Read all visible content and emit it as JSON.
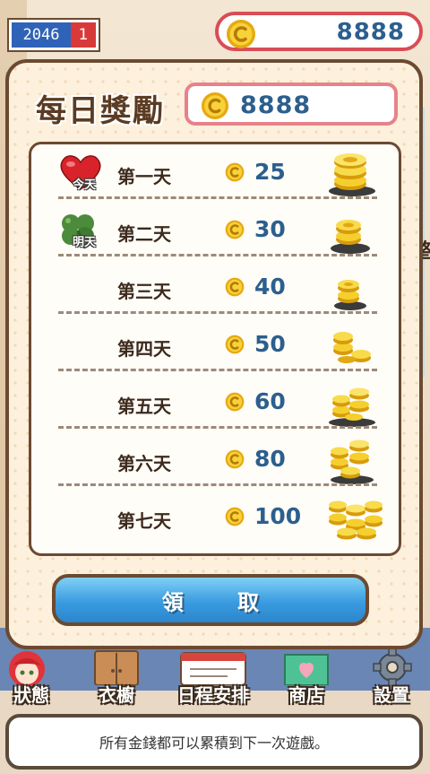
{
  "hud": {
    "year": "2046",
    "month": "1",
    "coins": "8888"
  },
  "panel": {
    "title": "每日獎勵",
    "coins": "8888"
  },
  "rewards": [
    {
      "day": "第一天",
      "amount": "25",
      "tag": "今天",
      "tag_icon": "heart-icon"
    },
    {
      "day": "第二天",
      "amount": "30",
      "tag": "明天",
      "tag_icon": "clover-icon"
    },
    {
      "day": "第三天",
      "amount": "40"
    },
    {
      "day": "第四天",
      "amount": "50"
    },
    {
      "day": "第五天",
      "amount": "60"
    },
    {
      "day": "第六天",
      "amount": "80"
    },
    {
      "day": "第七天",
      "amount": "100"
    }
  ],
  "claim_button": "領 取",
  "nav": [
    {
      "label": "狀態",
      "icon": "character-icon"
    },
    {
      "label": "衣櫥",
      "icon": "wardrobe-icon"
    },
    {
      "label": "日程安排",
      "icon": "schedule-icon"
    },
    {
      "label": "商店",
      "icon": "shop-icon"
    },
    {
      "label": "設置",
      "icon": "gear-icon"
    }
  ],
  "tip": "所有金錢都可以累積到下一次遊戲。",
  "side_text": "整",
  "colors": {
    "accent_blue": "#2c5f8e",
    "button_blue": "#3a9be0",
    "border_brown": "#6b4a31",
    "coin_gold": "#f2c21b",
    "pink_border": "#e8828a"
  }
}
